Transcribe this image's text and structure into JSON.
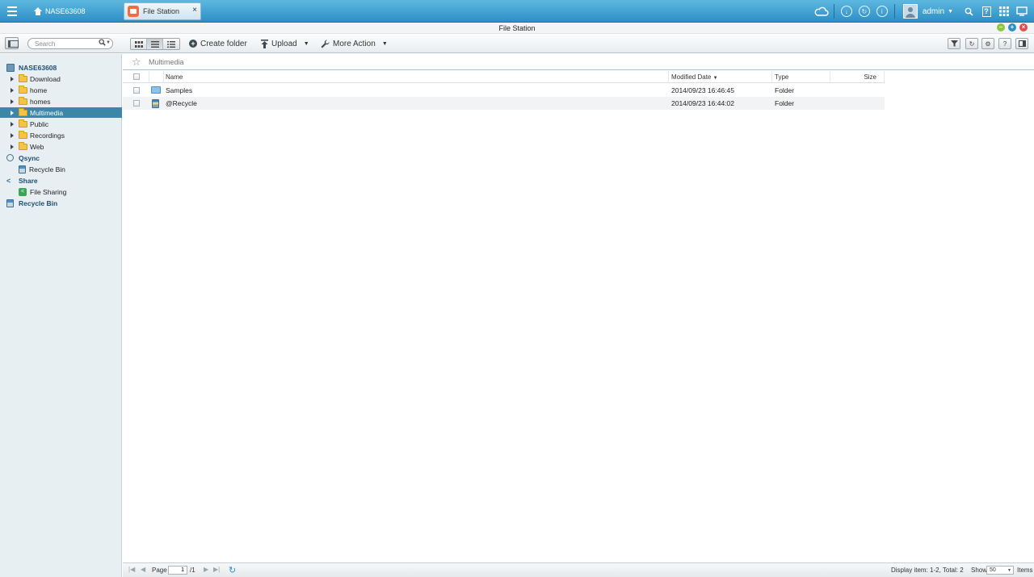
{
  "taskbar": {
    "home_label": "NASE63608",
    "app_tab_label": "File Station",
    "app_tab_close": "×",
    "user_name": "admin",
    "help_label": "?",
    "info_label": "i"
  },
  "window": {
    "title": "File Station"
  },
  "toolbar": {
    "search_placeholder": "Search",
    "create_folder_label": "Create folder",
    "upload_label": "Upload",
    "more_action_label": "More Action"
  },
  "sidebar": {
    "root_label": "NASE63608",
    "folders": [
      {
        "label": "Download"
      },
      {
        "label": "home"
      },
      {
        "label": "homes"
      },
      {
        "label": "Multimedia"
      },
      {
        "label": "Public"
      },
      {
        "label": "Recordings"
      },
      {
        "label": "Web"
      }
    ],
    "qsync_label": "Qsync",
    "qsync_recycle_label": "Recycle Bin",
    "share_label": "Share",
    "file_sharing_label": "File Sharing",
    "recycle_bin_label": "Recycle Bin"
  },
  "content": {
    "path": "Multimedia",
    "columns": {
      "name": "Name",
      "modified": "Modified Date",
      "type": "Type",
      "size": "Size"
    },
    "rows": [
      {
        "name": "Samples",
        "modified": "2014/09/23 16:46:45",
        "type": "Folder"
      },
      {
        "name": "@Recycle",
        "modified": "2014/09/23 16:44:02",
        "type": "Folder"
      }
    ]
  },
  "statusbar": {
    "page_label": "Page",
    "page_value": "1",
    "page_total": "/1",
    "display_info": "Display item: 1-2, Total: 2",
    "show_label": "Show",
    "show_value": "50",
    "items_label": "Items"
  },
  "colors": {
    "taskbar": "#2e8fc6",
    "selected": "#3c86a8",
    "minimize": "#8dc63f",
    "maximize": "#2e8fc6",
    "close": "#e84a4a"
  }
}
